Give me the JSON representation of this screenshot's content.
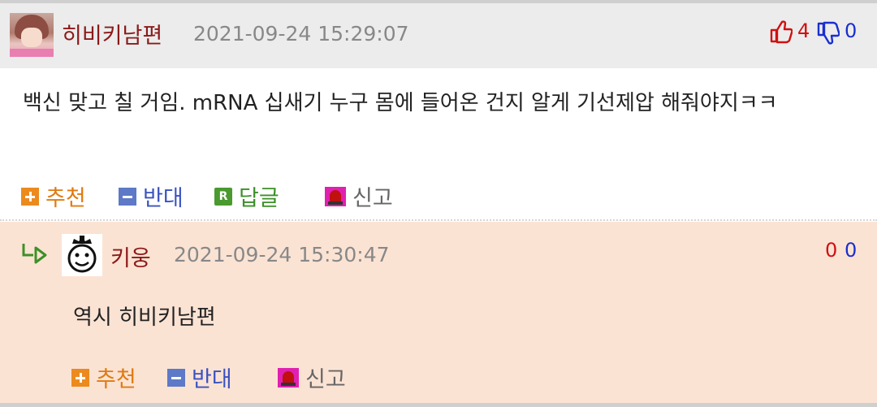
{
  "comment": {
    "nickname": "히비키남편",
    "datetime": "2021-09-24 15:29:07",
    "upvotes": "4",
    "downvotes": "0",
    "body": "백신 맞고 칠 거임. mRNA 십새기 누구 몸에 들어온 건지 알게 기선제압 해줘야지ㅋㅋ",
    "actions": {
      "recommend": "추천",
      "oppose": "반대",
      "reply": "답글",
      "report": "신고"
    }
  },
  "reply": {
    "nickname": "키웅",
    "datetime": "2021-09-24 15:30:47",
    "upvotes": "0",
    "downvotes": "0",
    "body": "역시 히비키남편",
    "actions": {
      "recommend": "추천",
      "oppose": "반대",
      "report": "신고"
    }
  },
  "icons": {
    "upvote": "thumbs-up-icon",
    "downvote": "thumbs-down-icon",
    "reply_arrow": "reply-arrow-icon",
    "report": "siren-icon"
  },
  "colors": {
    "nickname": "#8b1a1a",
    "upvote": "#d01010",
    "downvote": "#1a2fcf",
    "recommend": "#e07a10",
    "oppose": "#3a52c0",
    "reply": "#3c9028",
    "reply_bg": "#fbe3d4",
    "header_bg": "#ececec"
  }
}
